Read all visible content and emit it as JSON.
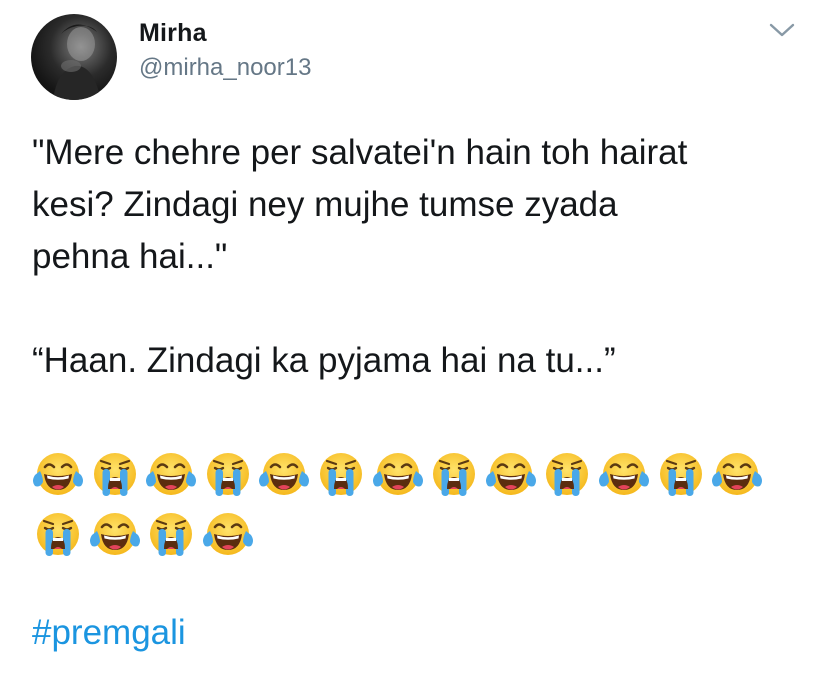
{
  "tweet": {
    "author": {
      "display_name": "Mirha",
      "handle": "@mirha_noor13",
      "avatar_icon": "avatar-photo"
    },
    "menu_icon": "chevron-down-icon",
    "text_lines": [
      "\"Mere chehre per salvatei'n hain toh hairat",
      "kesi? Zindagi ney mujhe tumse zyada",
      "pehna hai...\"",
      "“Haan. Zindagi ka pyjama hai na tu...”"
    ],
    "emoji_row_1": [
      "joy",
      "sob",
      "joy",
      "sob",
      "joy",
      "sob",
      "joy",
      "sob",
      "joy",
      "sob",
      "joy",
      "sob",
      "joy"
    ],
    "emoji_row_2": [
      "sob",
      "joy",
      "sob",
      "joy"
    ],
    "hashtag": "#premgali"
  },
  "colors": {
    "text": "#14171a",
    "secondary_text": "#657786",
    "link": "#1b95e0",
    "chevron": "#8899a6"
  }
}
